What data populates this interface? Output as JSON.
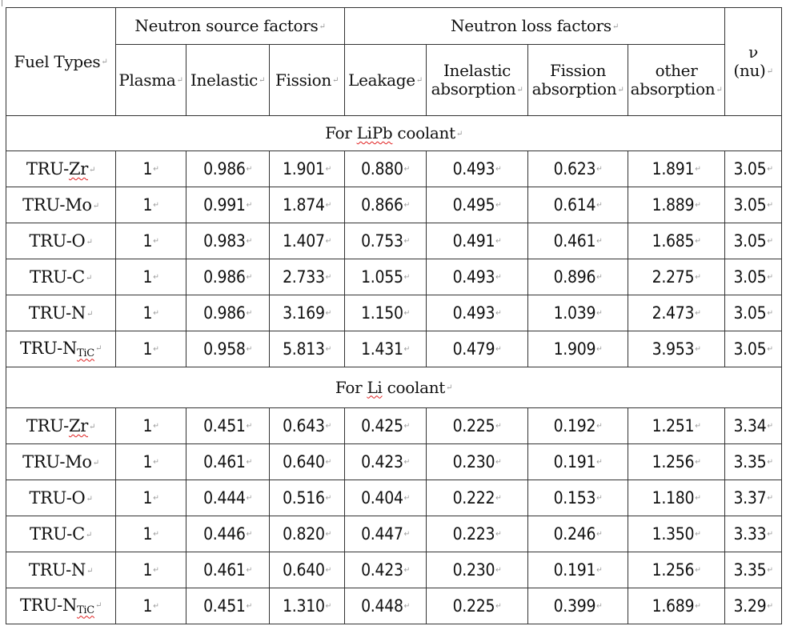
{
  "header": {
    "fuel_types": "Fuel Types",
    "source_group": "Neutron source factors",
    "loss_group": "Neutron loss factors",
    "nu_symbol": "ν",
    "nu_label": "(nu)",
    "columns": {
      "plasma": "Plasma",
      "inelastic": "Inelastic",
      "fission": "Fission",
      "leakage": "Leakage",
      "inelastic_absorption_1": "Inelastic",
      "inelastic_absorption_2": "absorption",
      "fission_absorption_1": "Fission",
      "fission_absorption_2": "absorption",
      "other_absorption_1": "other",
      "other_absorption_2": "absorption"
    }
  },
  "sections": [
    {
      "label_prefix": "For ",
      "label_coolant": "LiPb",
      "label_suffix": " coolant",
      "rows": [
        {
          "fuel": "TRU-",
          "fuel_el": "Zr",
          "fuel_sub": "",
          "plasma": "1",
          "inelastic": "0.986",
          "fission": "1.901",
          "leakage": "0.880",
          "inel_abs": "0.493",
          "fiss_abs": "0.623",
          "other_abs": "1.891",
          "nu": "3.05"
        },
        {
          "fuel": "TRU-",
          "fuel_el": "Mo",
          "fuel_sub": "",
          "plasma": "1",
          "inelastic": "0.991",
          "fission": "1.874",
          "leakage": "0.866",
          "inel_abs": "0.495",
          "fiss_abs": "0.614",
          "other_abs": "1.889",
          "nu": "3.05"
        },
        {
          "fuel": "TRU-",
          "fuel_el": "O",
          "fuel_sub": "",
          "plasma": "1",
          "inelastic": "0.983",
          "fission": "1.407",
          "leakage": "0.753",
          "inel_abs": "0.491",
          "fiss_abs": "0.461",
          "other_abs": "1.685",
          "nu": "3.05"
        },
        {
          "fuel": "TRU-",
          "fuel_el": "C",
          "fuel_sub": "",
          "plasma": "1",
          "inelastic": "0.986",
          "fission": "2.733",
          "leakage": "1.055",
          "inel_abs": "0.493",
          "fiss_abs": "0.896",
          "other_abs": "2.275",
          "nu": "3.05"
        },
        {
          "fuel": "TRU-",
          "fuel_el": "N",
          "fuel_sub": "",
          "plasma": "1",
          "inelastic": "0.986",
          "fission": "3.169",
          "leakage": "1.150",
          "inel_abs": "0.493",
          "fiss_abs": "1.039",
          "other_abs": "2.473",
          "nu": "3.05"
        },
        {
          "fuel": "TRU-",
          "fuel_el": "N",
          "fuel_sub": "TiC",
          "plasma": "1",
          "inelastic": "0.958",
          "fission": "5.813",
          "leakage": "1.431",
          "inel_abs": "0.479",
          "fiss_abs": "1.909",
          "other_abs": "3.953",
          "nu": "3.05"
        }
      ]
    },
    {
      "label_prefix": "For ",
      "label_coolant": "Li",
      "label_suffix": " coolant",
      "rows": [
        {
          "fuel": "TRU-",
          "fuel_el": "Zr",
          "fuel_sub": "",
          "plasma": "1",
          "inelastic": "0.451",
          "fission": "0.643",
          "leakage": "0.425",
          "inel_abs": "0.225",
          "fiss_abs": "0.192",
          "other_abs": "1.251",
          "nu": "3.34"
        },
        {
          "fuel": "TRU-",
          "fuel_el": "Mo",
          "fuel_sub": "",
          "plasma": "1",
          "inelastic": "0.461",
          "fission": "0.640",
          "leakage": "0.423",
          "inel_abs": "0.230",
          "fiss_abs": "0.191",
          "other_abs": "1.256",
          "nu": "3.35"
        },
        {
          "fuel": "TRU-",
          "fuel_el": "O",
          "fuel_sub": "",
          "plasma": "1",
          "inelastic": "0.444",
          "fission": "0.516",
          "leakage": "0.404",
          "inel_abs": "0.222",
          "fiss_abs": "0.153",
          "other_abs": "1.180",
          "nu": "3.37"
        },
        {
          "fuel": "TRU-",
          "fuel_el": "C",
          "fuel_sub": "",
          "plasma": "1",
          "inelastic": "0.446",
          "fission": "0.820",
          "leakage": "0.447",
          "inel_abs": "0.223",
          "fiss_abs": "0.246",
          "other_abs": "1.350",
          "nu": "3.33"
        },
        {
          "fuel": "TRU-",
          "fuel_el": "N",
          "fuel_sub": "",
          "plasma": "1",
          "inelastic": "0.461",
          "fission": "0.640",
          "leakage": "0.423",
          "inel_abs": "0.230",
          "fiss_abs": "0.191",
          "other_abs": "1.256",
          "nu": "3.35"
        },
        {
          "fuel": "TRU-",
          "fuel_el": "N",
          "fuel_sub": "TiC",
          "plasma": "1",
          "inelastic": "0.451",
          "fission": "1.310",
          "leakage": "0.448",
          "inel_abs": "0.225",
          "fiss_abs": "0.399",
          "other_abs": "1.689",
          "nu": "3.29"
        }
      ]
    }
  ],
  "paragraph_mark": "↵"
}
